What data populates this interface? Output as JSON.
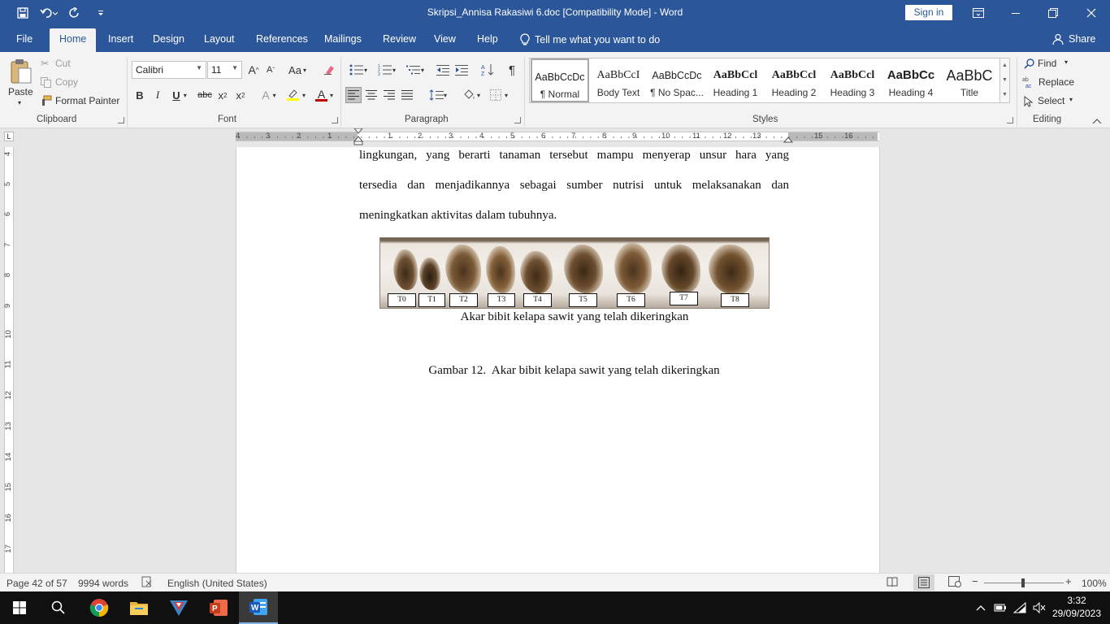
{
  "window": {
    "title": "Skripsi_Annisa Rakasiwi 6.doc [Compatibility Mode]  -  Word",
    "sign_in": "Sign in"
  },
  "tabs": [
    "File",
    "Home",
    "Insert",
    "Design",
    "Layout",
    "References",
    "Mailings",
    "Review",
    "View",
    "Help"
  ],
  "tell_me": "Tell me what you want to do",
  "share": "Share",
  "clipboard": {
    "paste": "Paste",
    "cut": "Cut",
    "copy": "Copy",
    "format_painter": "Format Painter",
    "label": "Clipboard"
  },
  "font": {
    "name": "Calibri",
    "size": "11",
    "label": "Font",
    "grow": "A",
    "shrink": "A",
    "change_case": "Aa",
    "bold": "B",
    "italic": "I",
    "underline": "U",
    "strikethrough": "abc",
    "subscript": "x",
    "superscript": "x",
    "text_effects": "A",
    "font_color": "A",
    "font_color_value": "#c00000",
    "highlight_value": "#ffff00"
  },
  "paragraph": {
    "label": "Paragraph"
  },
  "styles": {
    "label": "Styles",
    "items": [
      {
        "preview": "AaBbCcDc",
        "name": "¶ Normal"
      },
      {
        "preview": "AaBbCcI",
        "name": "Body Text"
      },
      {
        "preview": "AaBbCcDc",
        "name": "¶ No Spac..."
      },
      {
        "preview": "AaBbCcl",
        "name": "Heading 1"
      },
      {
        "preview": "AaBbCcl",
        "name": "Heading 2"
      },
      {
        "preview": "AaBbCcl",
        "name": "Heading 3"
      },
      {
        "preview": "AaBbCc",
        "name": "Heading 4"
      },
      {
        "preview": "AaBbC",
        "name": "Title"
      }
    ]
  },
  "editing": {
    "find": "Find",
    "replace": "Replace",
    "select": "Select",
    "label": "Editing"
  },
  "ruler": {
    "h_numbers": [
      "4",
      "3",
      "2",
      "1",
      "1",
      "2",
      "3",
      "4",
      "5",
      "6",
      "7",
      "8",
      "9",
      "10",
      "11",
      "12",
      "13",
      "15",
      "16"
    ],
    "v_numbers": [
      "4",
      "5",
      "6",
      "7",
      "8",
      "9",
      "10",
      "11",
      "12",
      "13",
      "14",
      "15",
      "16",
      "17"
    ]
  },
  "document": {
    "lines": [
      "lingkungan, yang berarti tanaman tersebut mampu menyerap unsur hara yang",
      "tersedia dan menjadikannya sebagai sumber nutrisi untuk melaksanakan dan",
      "meningkatkan aktivitas dalam tubuhnya."
    ],
    "photo_labels": [
      "T0",
      "T1",
      "T2",
      "T3",
      "T4",
      "T5",
      "T6",
      "T7",
      "T8"
    ],
    "photo_caption": "Akar bibit kelapa sawit yang telah dikeringkan",
    "figure_caption": "Gambar 12.  Akar bibit kelapa sawit yang telah dikeringkan"
  },
  "status": {
    "page": "Page 42 of 57",
    "words": "9994 words",
    "language": "English (United States)",
    "zoom": "100%"
  },
  "taskbar": {
    "time": "3:32",
    "date": "29/09/2023"
  }
}
